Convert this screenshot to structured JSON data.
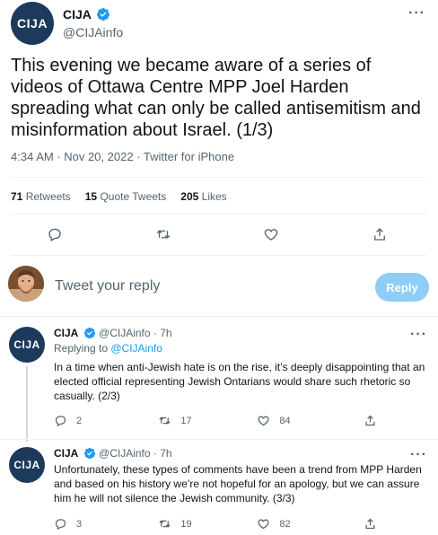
{
  "main_tweet": {
    "author_name": "CIJA",
    "author_handle": "@CIJAinfo",
    "avatar_text": "CIJA",
    "text": "This evening we became aware of a series of videos of Ottawa Centre MPP Joel Harden spreading what can only be called antisemitism and misinformation about Israel. (1/3)",
    "meta": "4:34 AM · Nov 20, 2022 · Twitter for iPhone",
    "retweets_count": "71",
    "retweets_label": "Retweets",
    "quotes_count": "15",
    "quotes_label": "Quote Tweets",
    "likes_count": "205",
    "likes_label": "Likes"
  },
  "reply_composer": {
    "placeholder": "Tweet your reply",
    "button_label": "Reply"
  },
  "thread": [
    {
      "author_name": "CIJA",
      "author_handle": "@CIJAinfo · 7h",
      "avatar_text": "CIJA",
      "replying_prefix": "Replying to ",
      "replying_to": "@CIJAinfo",
      "text": "In a time when anti-Jewish hate is on the rise, it’s deeply disappointing that an elected official representing Jewish Ontarians would share such rhetoric so casually. (2/3)",
      "replies": "2",
      "retweets": "17",
      "likes": "84"
    },
    {
      "author_name": "CIJA",
      "author_handle": "@CIJAinfo · 7h",
      "avatar_text": "CIJA",
      "text": "Unfortunately, these types of comments have been a trend from MPP Harden and based on his history we’re not hopeful for an apology, but we can assure him he will not silence the Jewish community. (3/3)",
      "replies": "3",
      "retweets": "19",
      "likes": "82"
    }
  ],
  "colors": {
    "brand_avatar": "#1d3a5c",
    "verified": "#1d9bf0",
    "link": "#1d9bf0",
    "reply_button": "#8ecdf8"
  }
}
